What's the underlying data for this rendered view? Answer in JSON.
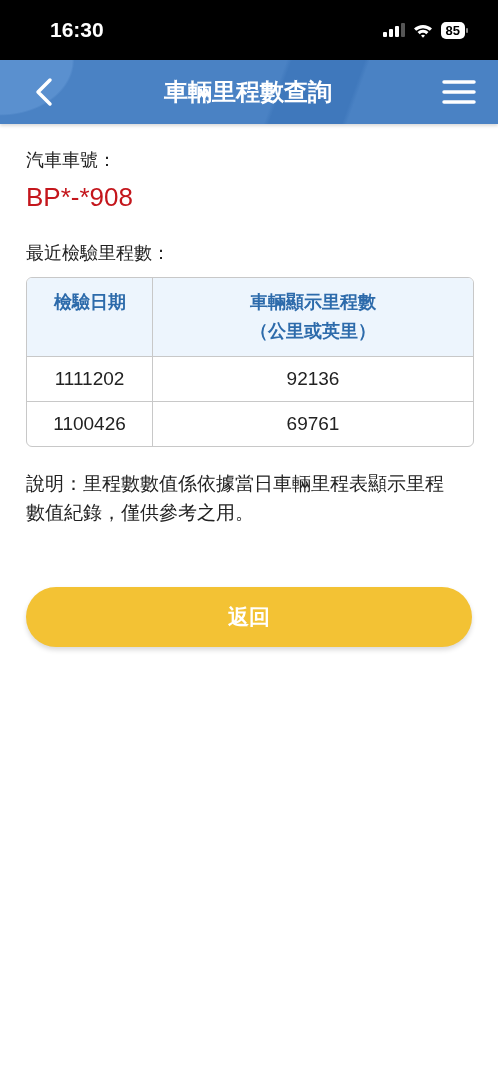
{
  "status_bar": {
    "time": "16:30",
    "battery": "85"
  },
  "header": {
    "title": "車輛里程數查詢"
  },
  "plate": {
    "label": "汽車車號：",
    "value": "BP*-*908"
  },
  "inspection": {
    "label": "最近檢驗里程數：",
    "table": {
      "columns": [
        "檢驗日期",
        "車輛顯示里程數（公里或英里）"
      ],
      "rows": [
        [
          "1111202",
          "92136"
        ],
        [
          "1100426",
          "69761"
        ]
      ]
    }
  },
  "note": "說明：里程數數值係依據當日車輛里程表顯示里程數值紀錄，僅供參考之用。",
  "buttons": [
    "返回"
  ]
}
